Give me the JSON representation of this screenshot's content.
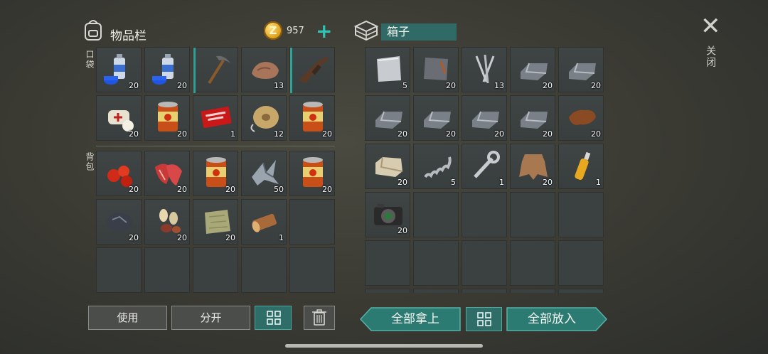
{
  "inventory": {
    "title": "物品栏",
    "coins": "957",
    "pocket_label": "口袋",
    "backpack_label": "背包",
    "pocket": [
      {
        "icon": "spray-can-icon",
        "qty": "20",
        "mark": false
      },
      {
        "icon": "spray-can-icon",
        "qty": "20",
        "mark": false
      },
      {
        "icon": "pickaxe-icon",
        "qty": "",
        "mark": true
      },
      {
        "icon": "rock-ore-icon",
        "qty": "13",
        "mark": false
      },
      {
        "icon": "assault-rifle-icon",
        "qty": "",
        "mark": true
      },
      {
        "icon": "bandage-icon",
        "qty": "20",
        "mark": false
      },
      {
        "icon": "food-can-icon",
        "qty": "20",
        "mark": false
      },
      {
        "icon": "coupon-icon",
        "qty": "1",
        "mark": false
      },
      {
        "icon": "wire-spool-icon",
        "qty": "12",
        "mark": false
      },
      {
        "icon": "food-can-icon",
        "qty": "20",
        "mark": false
      }
    ],
    "backpack": [
      {
        "icon": "berries-icon",
        "qty": "20"
      },
      {
        "icon": "raw-meat-icon",
        "qty": "20"
      },
      {
        "icon": "food-can-icon",
        "qty": "20"
      },
      {
        "icon": "scrap-metal-icon",
        "qty": "50"
      },
      {
        "icon": "food-can-icon",
        "qty": "20"
      },
      {
        "icon": "coal-ore-icon",
        "qty": "20"
      },
      {
        "icon": "seeds-icon",
        "qty": "20"
      },
      {
        "icon": "cloth-icon",
        "qty": "20"
      },
      {
        "icon": "log-icon",
        "qty": "1"
      },
      {
        "icon": "",
        "qty": ""
      },
      {
        "icon": "",
        "qty": ""
      },
      {
        "icon": "",
        "qty": ""
      },
      {
        "icon": "",
        "qty": ""
      },
      {
        "icon": "",
        "qty": ""
      },
      {
        "icon": "",
        "qty": ""
      }
    ],
    "use_label": "使用",
    "split_label": "分开"
  },
  "chest": {
    "name": "箱子",
    "items": [
      {
        "icon": "aluminum-sheet-icon",
        "qty": "5"
      },
      {
        "icon": "iron-plate-icon",
        "qty": "20"
      },
      {
        "icon": "nails-icon",
        "qty": "13"
      },
      {
        "icon": "metal-ingot-icon",
        "qty": "20"
      },
      {
        "icon": "metal-ingot-icon",
        "qty": "20"
      },
      {
        "icon": "metal-ingot-icon",
        "qty": "20"
      },
      {
        "icon": "metal-ingot-icon",
        "qty": "20"
      },
      {
        "icon": "metal-ingot-icon",
        "qty": "20"
      },
      {
        "icon": "metal-ingot-icon",
        "qty": "20"
      },
      {
        "icon": "leather-icon",
        "qty": "20"
      },
      {
        "icon": "stone-block-icon",
        "qty": "20"
      },
      {
        "icon": "spring-icon",
        "qty": "5"
      },
      {
        "icon": "wrench-icon",
        "qty": "1"
      },
      {
        "icon": "animal-hide-icon",
        "qty": "20"
      },
      {
        "icon": "bottle-icon",
        "qty": "1"
      },
      {
        "icon": "camera-icon",
        "qty": "20"
      },
      {
        "icon": "",
        "qty": ""
      },
      {
        "icon": "",
        "qty": ""
      },
      {
        "icon": "",
        "qty": ""
      },
      {
        "icon": "",
        "qty": ""
      },
      {
        "icon": "",
        "qty": ""
      },
      {
        "icon": "",
        "qty": ""
      },
      {
        "icon": "",
        "qty": ""
      },
      {
        "icon": "",
        "qty": ""
      },
      {
        "icon": "",
        "qty": ""
      },
      {
        "icon": "",
        "qty": ""
      },
      {
        "icon": "",
        "qty": ""
      },
      {
        "icon": "",
        "qty": ""
      },
      {
        "icon": "",
        "qty": ""
      },
      {
        "icon": "",
        "qty": ""
      }
    ],
    "take_all_label": "全部拿上",
    "put_all_label": "全部放入"
  },
  "close": {
    "label": "关闭"
  },
  "colors": {
    "accent": "#2fa396",
    "teal_button": "#2c7b73",
    "coin": "#f2b52a"
  }
}
